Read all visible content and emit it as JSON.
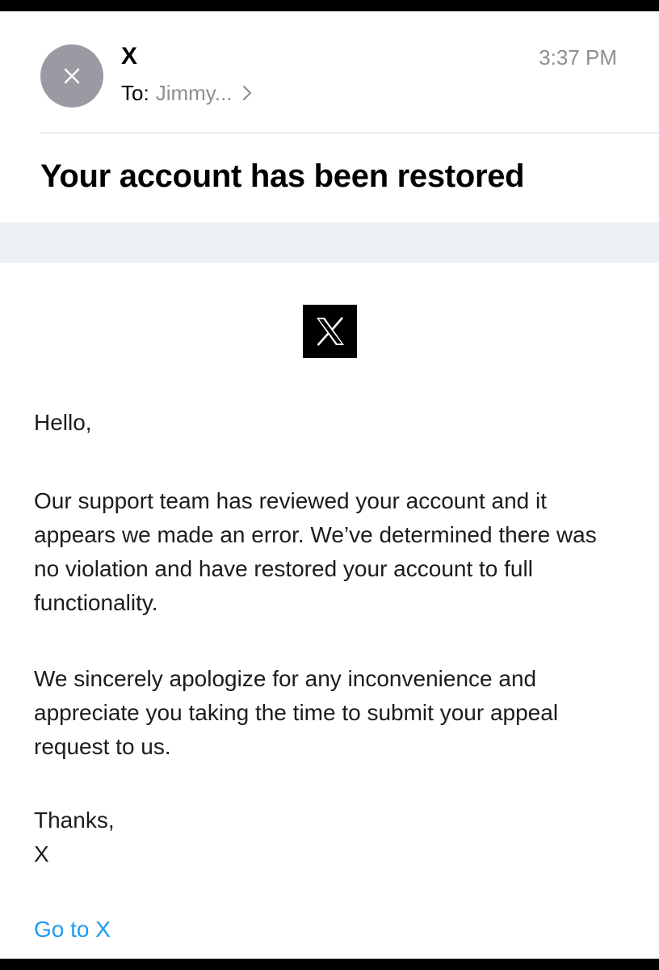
{
  "header": {
    "avatar_letter": "X",
    "sender_name": "X",
    "to_label": "To:",
    "recipient": "Jimmy...",
    "time": "3:37 PM"
  },
  "subject": "Your account has been restored",
  "body": {
    "greeting": "Hello,",
    "paragraphs": [
      "Our support team has reviewed your account and it appears we made an error. We’ve determined there was no violation and have restored your account to full functionality.",
      "We sincerely apologize for any inconvenience and appreciate you taking the time to submit your appeal request to us."
    ],
    "signoff": "Thanks,",
    "signature": "X",
    "cta_link": "Go to X"
  },
  "icons": {
    "avatar": "x-letter-icon",
    "recipient_details": "chevron-right-icon",
    "brand": "x-logo-icon"
  },
  "colors": {
    "link": "#1d9bf0",
    "avatar_bg": "#9a9aa2",
    "muted_text": "#8e8e93",
    "band_bg": "#eef1f4"
  }
}
